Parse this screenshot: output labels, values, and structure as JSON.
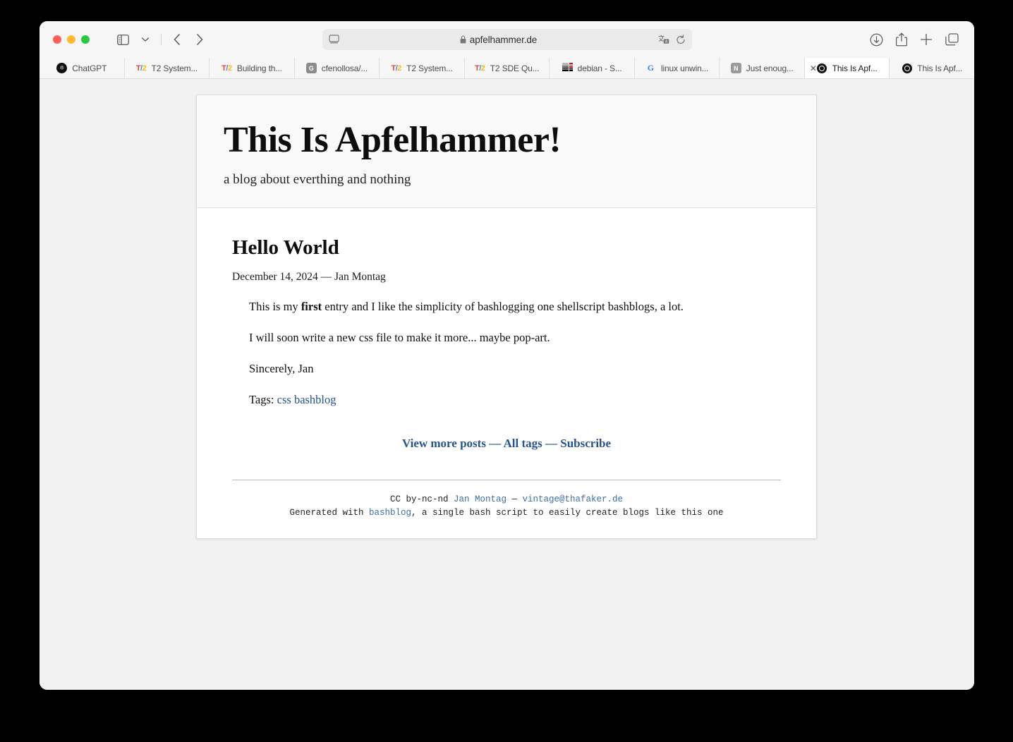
{
  "window": {
    "traffic_lights": [
      "close",
      "minimize",
      "maximize"
    ]
  },
  "toolbar": {
    "sidebar_icon": "sidebar-icon",
    "chevron_icon": "chevron-down-icon",
    "back_icon": "back-arrow-icon",
    "forward_icon": "forward-arrow-icon",
    "download_icon": "download-icon",
    "share_icon": "share-icon",
    "new_tab_icon": "plus-icon",
    "tab_overview_icon": "tab-overview-icon"
  },
  "address_bar": {
    "reader_icon": "reader-view-icon",
    "lock_icon": "lock-icon",
    "url": "apfelhammer.de",
    "translate_icon": "translate-icon",
    "reload_icon": "reload-icon"
  },
  "tabs": [
    {
      "title": "ChatGPT",
      "favicon": "chatgpt",
      "active": false,
      "closable": false
    },
    {
      "title": "T2 System...",
      "favicon": "t2",
      "active": false,
      "closable": false
    },
    {
      "title": "Building th...",
      "favicon": "t2",
      "active": false,
      "closable": false
    },
    {
      "title": "cfenollosa/...",
      "favicon": "github",
      "active": false,
      "closable": false
    },
    {
      "title": "T2 System...",
      "favicon": "t2",
      "active": false,
      "closable": false
    },
    {
      "title": "T2 SDE Qu...",
      "favicon": "t2",
      "active": false,
      "closable": false
    },
    {
      "title": "debian - S...",
      "favicon": "debian",
      "active": false,
      "closable": false
    },
    {
      "title": "linux unwin...",
      "favicon": "google",
      "active": false,
      "closable": false
    },
    {
      "title": "Just enoug...",
      "favicon": "notion",
      "active": false,
      "closable": false
    },
    {
      "title": "This Is Apf...",
      "favicon": "circle",
      "active": true,
      "closable": true,
      "close_label": "✕"
    },
    {
      "title": "This Is Apf...",
      "favicon": "circle",
      "active": false,
      "closable": false
    }
  ],
  "blog": {
    "title": "This Is Apfelhammer!",
    "subtitle": "a blog about everthing and nothing",
    "post": {
      "title": "Hello World",
      "meta": "December 14, 2024 — Jan Montag",
      "para1_pre": "This is my ",
      "para1_bold": "first",
      "para1_post": " entry and I like the simplicity of bashlogging one shellscript bashblogs, a lot.",
      "para2": "I will soon write a new css file to make it more... maybe pop-art.",
      "para3": "Sincerely, Jan",
      "tags_label": "Tags: ",
      "tags": [
        "css",
        "bashblog"
      ]
    },
    "nav": {
      "view_more": "View more posts",
      "sep1": " — ",
      "all_tags": "All tags",
      "sep2": " — ",
      "subscribe": "Subscribe"
    },
    "footer": {
      "license": "CC by-nc-nd ",
      "author": "Jan Montag",
      "dash": " — ",
      "email": "vintage@thafaker.de",
      "generated_pre": "Generated with ",
      "generated_link": "bashblog",
      "generated_post": ", a single bash script to easily create blogs like this one"
    }
  },
  "colors": {
    "link": "#27548d",
    "footer_link": "#3c6fa8",
    "page_bg": "#f2f2f2",
    "card_bg": "#ffffff",
    "header_bg": "#f9f9f9"
  }
}
